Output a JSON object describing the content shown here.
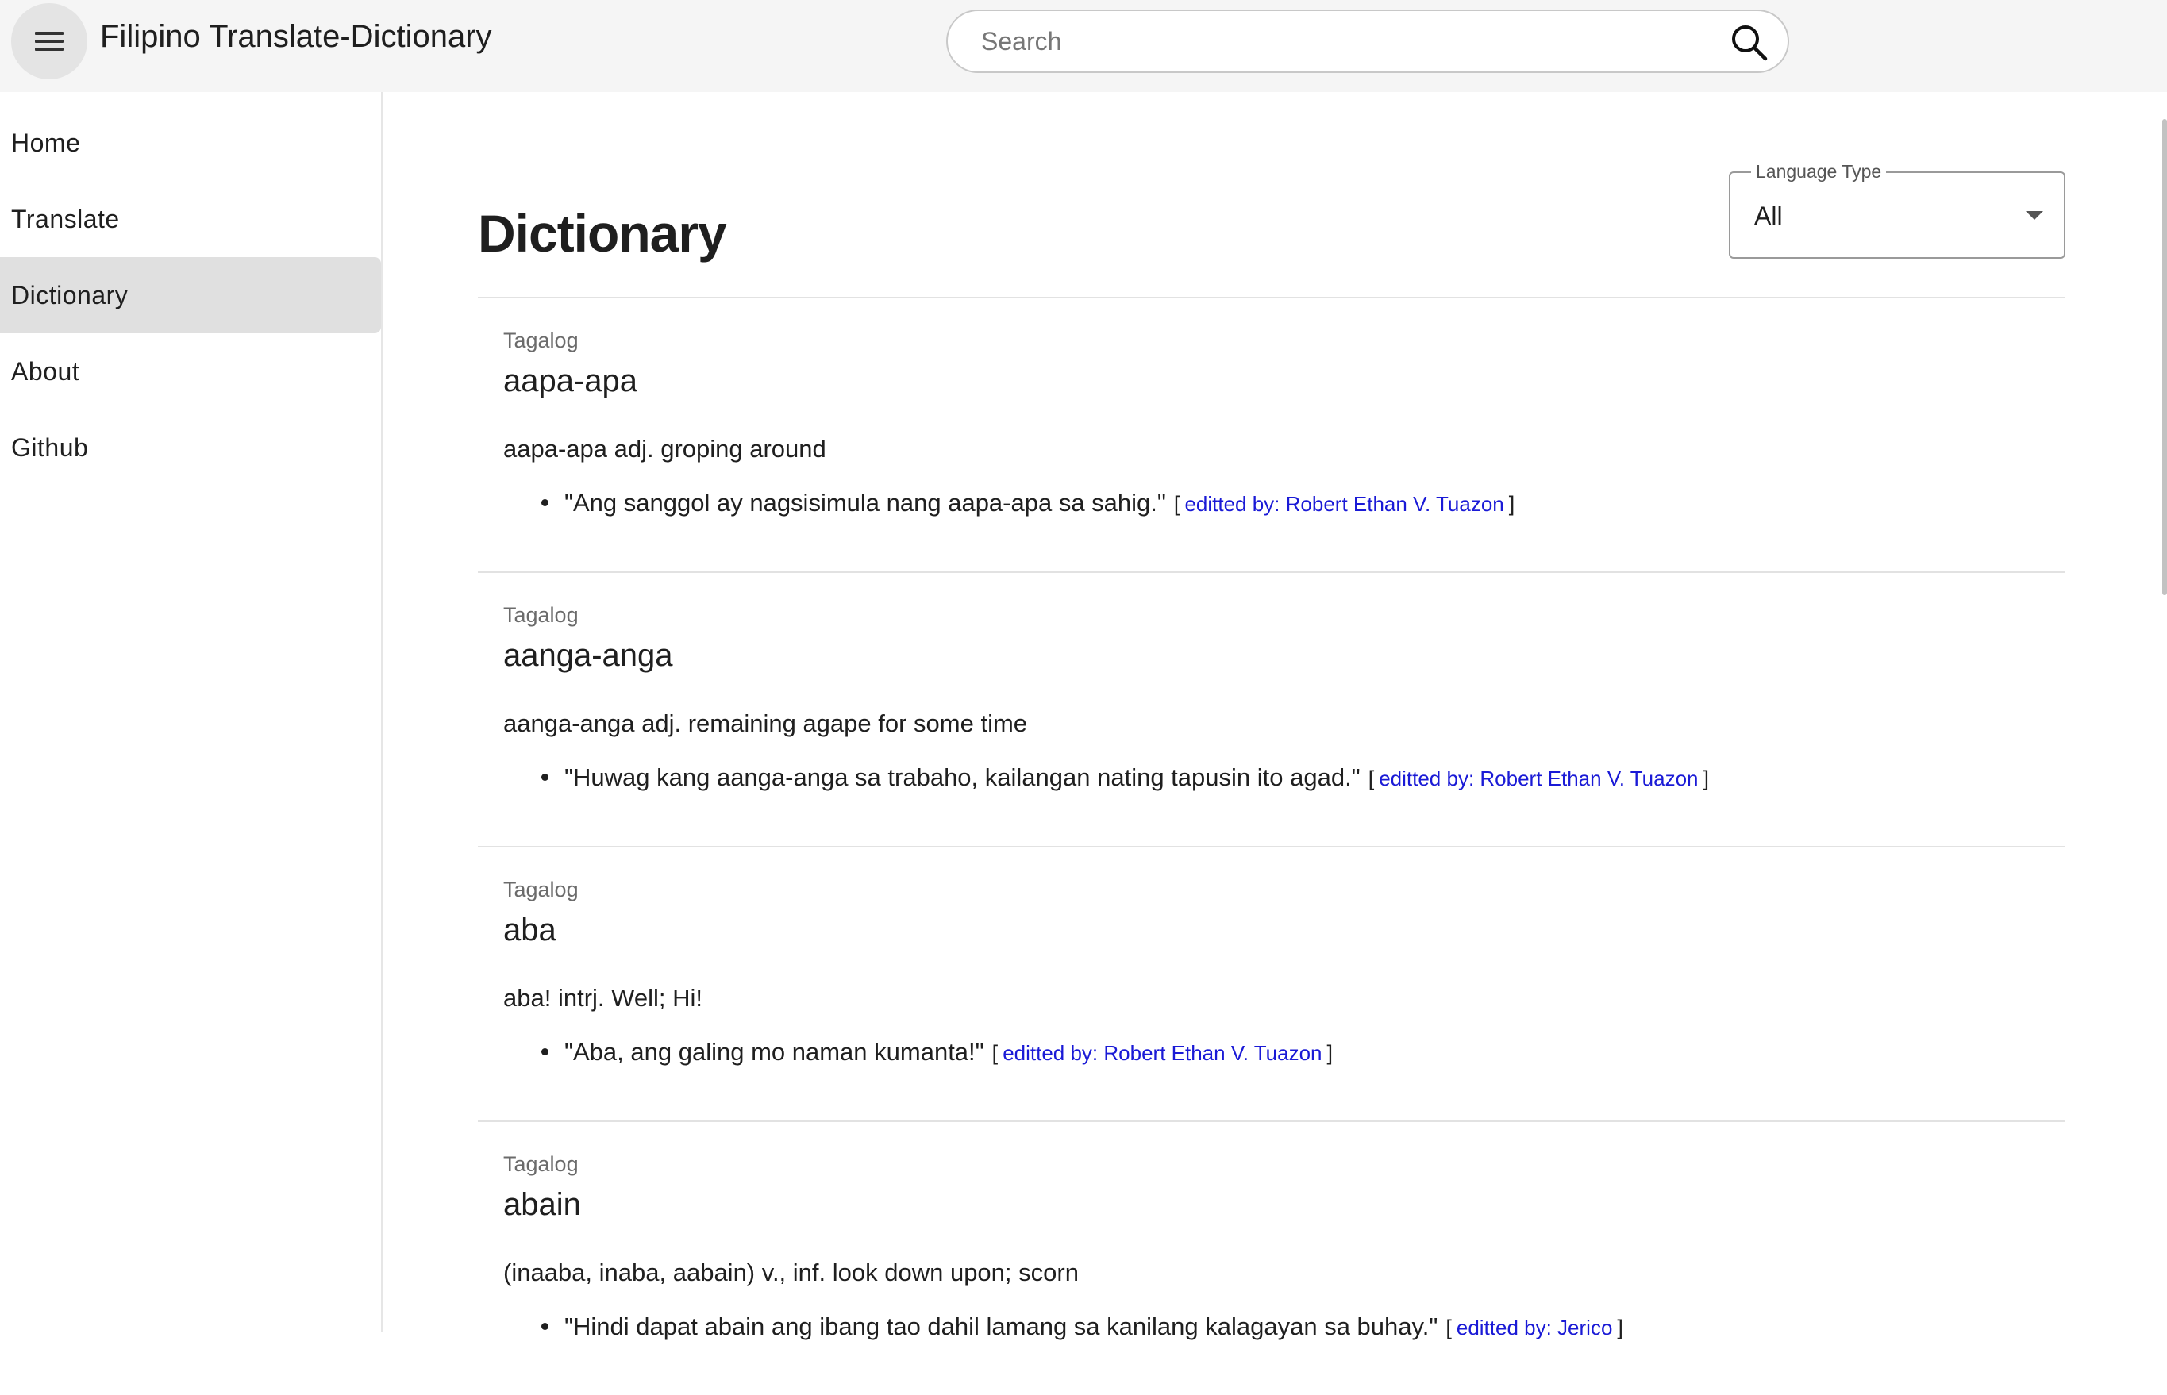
{
  "app": {
    "title": "Filipino Translate-Dictionary"
  },
  "search": {
    "placeholder": "Search",
    "value": ""
  },
  "sidebar": {
    "items": [
      {
        "label": "Home"
      },
      {
        "label": "Translate"
      },
      {
        "label": "Dictionary",
        "active": true
      },
      {
        "label": "About"
      },
      {
        "label": "Github"
      }
    ]
  },
  "main": {
    "title": "Dictionary",
    "filter": {
      "label": "Language Type",
      "value": "All"
    },
    "entries": [
      {
        "language": "Tagalog",
        "word": "aapa-apa",
        "definition": "aapa-apa adj. groping around",
        "example": "\"Ang sanggol ay nagsisimula nang aapa-apa sa sahig.\"",
        "bracket_open": "[",
        "editor": "editted by: Robert Ethan V. Tuazon",
        "bracket_close": "]"
      },
      {
        "language": "Tagalog",
        "word": "aanga-anga",
        "definition": "aanga-anga adj. remaining agape for some time",
        "example": "\"Huwag kang aanga-anga sa trabaho, kailangan nating tapusin ito agad.\"",
        "bracket_open": "[",
        "editor": "editted by: Robert Ethan V. Tuazon",
        "bracket_close": "]"
      },
      {
        "language": "Tagalog",
        "word": "aba",
        "definition": "aba! intrj. Well; Hi!",
        "example": "\"Aba, ang galing mo naman kumanta!\"",
        "bracket_open": "[",
        "editor": "editted by: Robert Ethan V. Tuazon",
        "bracket_close": "]"
      },
      {
        "language": "Tagalog",
        "word": "abain",
        "definition": "(inaaba, inaba, aabain) v., inf. look down upon; scorn",
        "example": "\"Hindi dapat abain ang ibang tao dahil lamang sa kanilang kalagayan sa buhay.\"",
        "bracket_open": "[",
        "editor": "editted by: Jerico",
        "bracket_close": "]"
      }
    ]
  },
  "colors": {
    "appbar_bg": "#f5f5f5",
    "active_nav_bg": "#e0e0e0",
    "link": "#1a1ad6",
    "divider": "#e2e2e2"
  },
  "icons": {
    "menu": "hamburger-menu-icon",
    "search": "magnifier-search-icon",
    "dropdown": "chevron-down-icon"
  }
}
